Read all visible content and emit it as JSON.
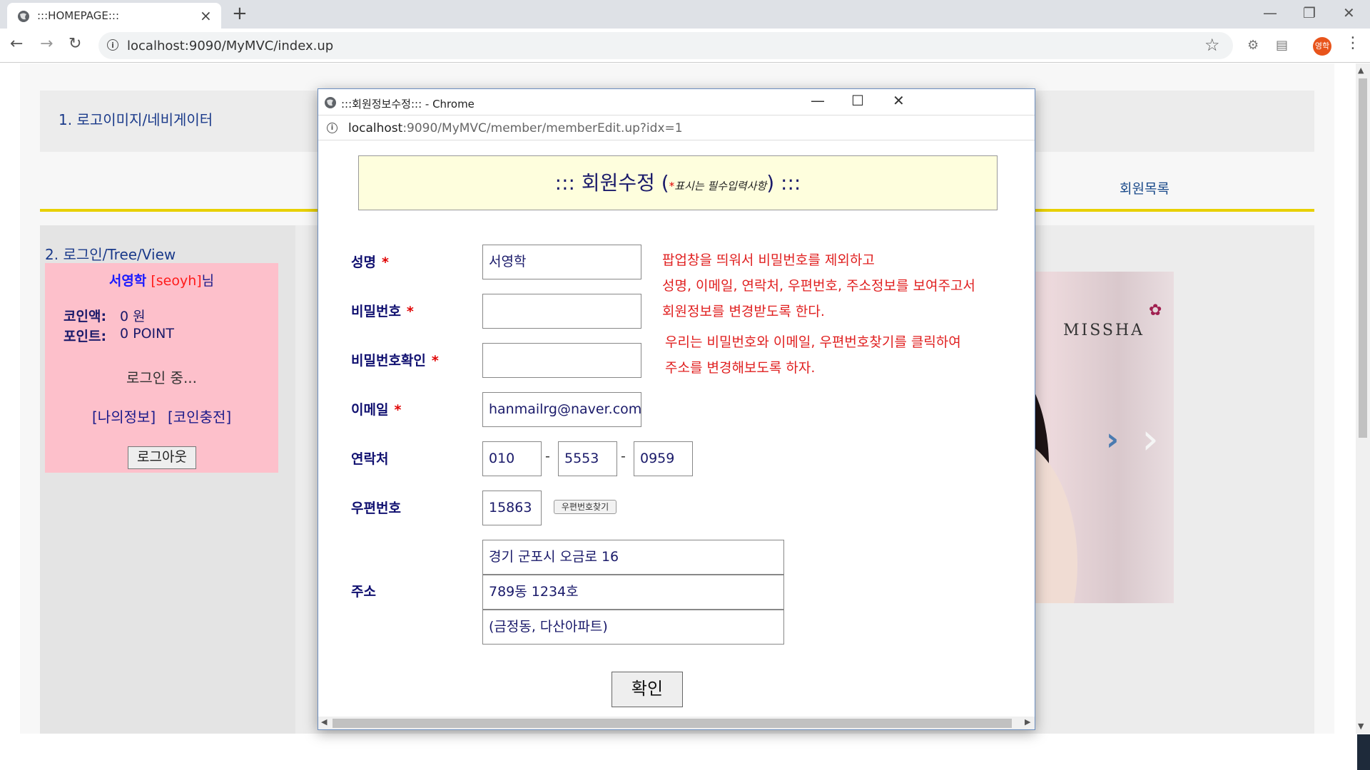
{
  "browser": {
    "tab_title": ":::HOMEPAGE:::",
    "tab_close": "×",
    "new_tab": "+",
    "url": "localhost:9090/MyMVC/index.up",
    "avatar": "영학",
    "icons": [
      "globe-icon",
      "back-icon",
      "forward-icon",
      "reload-icon",
      "info-icon",
      "star-icon",
      "extension-icon",
      "cast-icon",
      "menu-icon"
    ]
  },
  "page": {
    "header_text": "1. 로고이미지/네비게이터",
    "member_list_link": "회원목록",
    "login_title": "2. 로그인/Tree/View",
    "login_box": {
      "name": "서영학",
      "userid": "[seoyh]",
      "suffix": "님",
      "coin_label": "코인액:",
      "coin_value": "0 원",
      "point_label": "포인트:",
      "point_value": "0 POINT",
      "status": "로그인 중...",
      "my_info_link": "[나의정보]",
      "coin_charge_link": "[코인충전]",
      "logout_button": "로그아웃"
    },
    "banner": {
      "brand": "MISSHA",
      "next_icon": "chevron-right-icon"
    },
    "colors": {
      "yellow_rule": "#e8d000",
      "login_box": "#fdc0cb"
    }
  },
  "popup": {
    "window_title": ":::회원정보수정::: - Chrome",
    "url_host": "localhost",
    "url_path": ":9090/MyMVC/member/memberEdit.up?idx=1",
    "heading_main": "::: 회원수정 (",
    "heading_star": "*",
    "heading_note": "표시는 필수입력사항",
    "heading_end": ") :::",
    "fields": {
      "name_label": "성명",
      "name_value": "서영학",
      "pw_label": "비밀번호",
      "pw_value": "",
      "pw_confirm_label": "비밀번호확인",
      "pw_confirm_value": "",
      "email_label": "이메일",
      "email_value": "hanmailrg@naver.com",
      "phone_label": "연락처",
      "phone1": "010",
      "phone2": "5553",
      "phone3": "0959",
      "zip_label": "우편번호",
      "zip_value": "15863",
      "zip_button": "우편번호찾기",
      "addr_label": "주소",
      "addr1": "경기 군포시 오금로 16",
      "addr2": "789동 1234호",
      "addr3": " (금정동, 다산아파트)",
      "required_mark": "*",
      "dash": "-"
    },
    "notes": {
      "line1": "팝업창을 띄워서 비밀번호를 제외하고",
      "line2": "성명, 이메일, 연락처, 우편번호, 주소정보를 보여주고서",
      "line3": "회원정보를 변경받도록 한다.",
      "line4": "우리는 비밀번호와 이메일, 우편번호찾기를 클릭하여",
      "line5": "주소를 변경해보도록 하자."
    },
    "ok_button": "확인"
  }
}
